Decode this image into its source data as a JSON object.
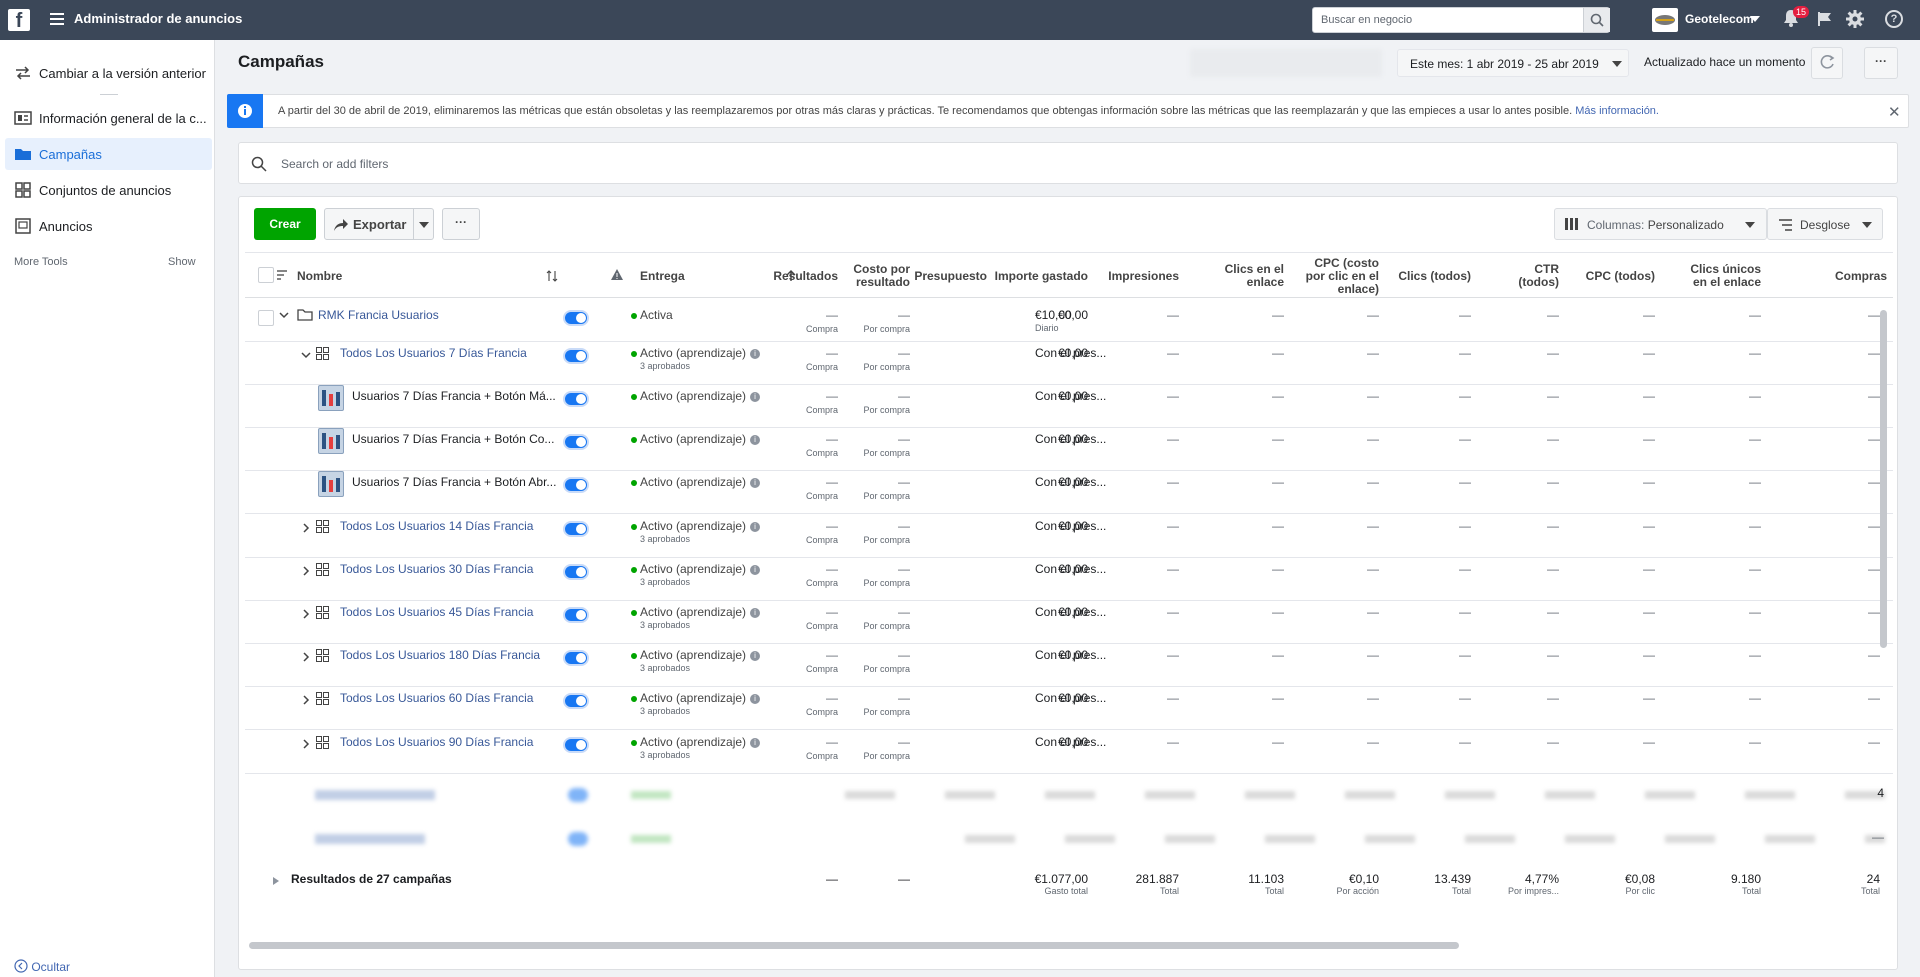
{
  "topbar": {
    "app_title": "Administrador de anuncios",
    "search_placeholder": "Buscar en negocio",
    "business_name": "Geotelecom",
    "notification_count": "15"
  },
  "sidebar": {
    "items": [
      {
        "label": "Cambiar a la versión anterior",
        "icon": "switch-icon"
      },
      {
        "label": "Información general de la c...",
        "icon": "overview-icon"
      },
      {
        "label": "Campañas",
        "icon": "folder-icon"
      },
      {
        "label": "Conjuntos de anuncios",
        "icon": "grid-icon"
      },
      {
        "label": "Anuncios",
        "icon": "ad-icon"
      }
    ],
    "more_tools": "More Tools",
    "show": "Show",
    "hide": "Ocultar"
  },
  "header": {
    "title": "Campañas",
    "date_range": "Este mes: 1 abr 2019 - 25 abr 2019",
    "updated": "Actualizado hace un momento"
  },
  "notice": {
    "text": "A partir del 30 de abril de 2019, eliminaremos las métricas que están obsoletas y las reemplazaremos por otras más claras y prácticas. Te recomendamos que obtengas información sobre las métricas que las reemplazarán y que las empieces a usar lo antes posible.",
    "link": "Más información."
  },
  "filter": {
    "placeholder": "Search or add filters"
  },
  "toolbar": {
    "create": "Crear",
    "export": "Exportar",
    "columns_label": "Columnas:",
    "columns_value": "Personalizado",
    "breakdown": "Desglose"
  },
  "columns": {
    "name": "Nombre",
    "delivery": "Entrega",
    "results": "Resultados",
    "cost_line1": "Costo por",
    "cost_line2": "resultado",
    "budget": "Presupuesto",
    "spent": "Importe gastado",
    "impressions": "Impresiones",
    "link_clicks_1": "Clics en el",
    "link_clicks_2": "enlace",
    "cpc_1": "CPC (costo",
    "cpc_2": "por clic en el",
    "cpc_3": "enlace)",
    "clicks_all": "Clics (todos)",
    "ctr_1": "CTR",
    "ctr_2": "(todos)",
    "cpc_all": "CPC (todos)",
    "unique_1": "Clics únicos",
    "unique_2": "en el enlace",
    "purchases": "Compras"
  },
  "rows": [
    {
      "name": "RMK Francia Usuarios",
      "delivery": "Activa",
      "delivery_sub": "",
      "result_sub": "Compra",
      "cost_sub": "Por compra",
      "budget": "€10,00",
      "budget_sub": "Diario",
      "spent": "€0,00",
      "dash": "—"
    },
    {
      "name": "Todos Los Usuarios 7 Días Francia",
      "delivery": "Activo (aprendizaje)",
      "delivery_sub": "3 aprobados",
      "result_sub": "Compra",
      "cost_sub": "Por compra",
      "budget": "Con el pres...",
      "budget_sub": "",
      "spent": "€0,00",
      "dash": "—"
    },
    {
      "name": "Usuarios 7 Días Francia + Botón Má...",
      "delivery": "Activo (aprendizaje)",
      "delivery_sub": "",
      "result_sub": "Compra",
      "cost_sub": "Por compra",
      "budget": "Con el pres...",
      "budget_sub": "",
      "spent": "€0,00",
      "dash": "—"
    },
    {
      "name": "Usuarios 7 Días Francia + Botón Co...",
      "delivery": "Activo (aprendizaje)",
      "delivery_sub": "",
      "result_sub": "Compra",
      "cost_sub": "Por compra",
      "budget": "Con el pres...",
      "budget_sub": "",
      "spent": "€0,00",
      "dash": "—"
    },
    {
      "name": "Usuarios 7 Días Francia + Botón Abr...",
      "delivery": "Activo (aprendizaje)",
      "delivery_sub": "",
      "result_sub": "Compra",
      "cost_sub": "Por compra",
      "budget": "Con el pres...",
      "budget_sub": "",
      "spent": "€0,00",
      "dash": "—"
    },
    {
      "name": "Todos Los Usuarios 14 Días Francia",
      "delivery": "Activo (aprendizaje)",
      "delivery_sub": "3 aprobados",
      "result_sub": "Compra",
      "cost_sub": "Por compra",
      "budget": "Con el pres...",
      "budget_sub": "",
      "spent": "€0,00",
      "dash": "—"
    },
    {
      "name": "Todos Los Usuarios 30 Días Francia",
      "delivery": "Activo (aprendizaje)",
      "delivery_sub": "3 aprobados",
      "result_sub": "Compra",
      "cost_sub": "Por compra",
      "budget": "Con el pres...",
      "budget_sub": "",
      "spent": "€0,00",
      "dash": "—"
    },
    {
      "name": "Todos Los Usuarios 45 Días Francia",
      "delivery": "Activo (aprendizaje)",
      "delivery_sub": "3 aprobados",
      "result_sub": "Compra",
      "cost_sub": "Por compra",
      "budget": "Con el pres...",
      "budget_sub": "",
      "spent": "€0,00",
      "dash": "—"
    },
    {
      "name": "Todos Los Usuarios 180 Días Francia",
      "delivery": "Activo (aprendizaje)",
      "delivery_sub": "3 aprobados",
      "result_sub": "Compra",
      "cost_sub": "Por compra",
      "budget": "Con el pres...",
      "budget_sub": "",
      "spent": "€0,00",
      "dash": "—"
    },
    {
      "name": "Todos Los Usuarios 60 Días Francia",
      "delivery": "Activo (aprendizaje)",
      "delivery_sub": "3 aprobados",
      "result_sub": "Compra",
      "cost_sub": "Por compra",
      "budget": "Con el pres...",
      "budget_sub": "",
      "spent": "€0,00",
      "dash": "—"
    },
    {
      "name": "Todos Los Usuarios 90 Días Francia",
      "delivery": "Activo (aprendizaje)",
      "delivery_sub": "3 aprobados",
      "result_sub": "Compra",
      "cost_sub": "Por compra",
      "budget": "Con el pres...",
      "budget_sub": "",
      "spent": "€0,00",
      "dash": "—"
    }
  ],
  "blurred_purchases": [
    "4",
    "—",
    "—"
  ],
  "summary": {
    "label": "Resultados de 27 campañas",
    "results": "—",
    "cost": "—",
    "spent": "€1.077,00",
    "spent_sub": "Gasto total",
    "impressions": "281.887",
    "impressions_sub": "Total",
    "link_clicks": "11.103",
    "link_clicks_sub": "Total",
    "cpc": "€0,10",
    "cpc_sub": "Por acción",
    "clicks_all": "13.439",
    "clicks_all_sub": "Total",
    "ctr": "4,77%",
    "ctr_sub": "Por impres...",
    "cpc_all": "€0,08",
    "cpc_all_sub": "Por clic",
    "unique": "9.180",
    "unique_sub": "Total",
    "purchases": "24",
    "purchases_sub": "Total"
  },
  "colors": {
    "topbar": "#3b4758",
    "accent": "#1877f2",
    "create": "#00a400",
    "link": "#385898"
  }
}
